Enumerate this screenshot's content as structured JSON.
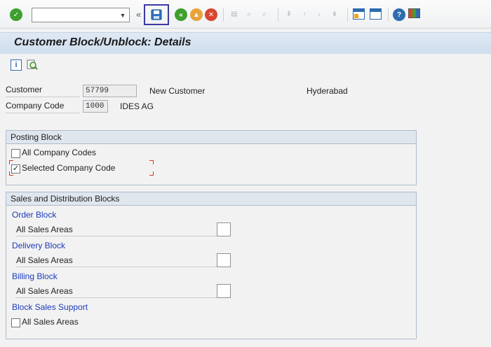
{
  "window": {
    "title": "Customer Block/Unblock: Details"
  },
  "toolbar": {
    "command_placeholder": "",
    "overflow_glyph": "«"
  },
  "header": {
    "customer_label": "Customer",
    "customer_value": "57799",
    "customer_name": "New Customer",
    "customer_city": "Hyderabad",
    "company_code_label": "Company Code",
    "company_code_value": "1000",
    "company_name": "IDES AG"
  },
  "posting_block": {
    "title": "Posting Block",
    "all_company_codes_label": "All Company Codes",
    "all_company_codes_checked": false,
    "selected_company_code_label": "Selected Company Code",
    "selected_company_code_checked": true
  },
  "sd_blocks": {
    "title": "Sales and Distribution Blocks",
    "order_block": {
      "title": "Order Block",
      "row_label": "All Sales Areas"
    },
    "delivery_block": {
      "title": "Delivery Block",
      "row_label": "All Sales Areas"
    },
    "billing_block": {
      "title": "Billing Block",
      "row_label": "All Sales Areas"
    },
    "block_sales_support": {
      "title": "Block Sales Support",
      "row_label": "All Sales Areas",
      "checked": false
    }
  },
  "colors": {
    "accent": "#1c3bb9",
    "save_highlight": "#3c3aa4",
    "title_bg": "#d9e5f1"
  }
}
